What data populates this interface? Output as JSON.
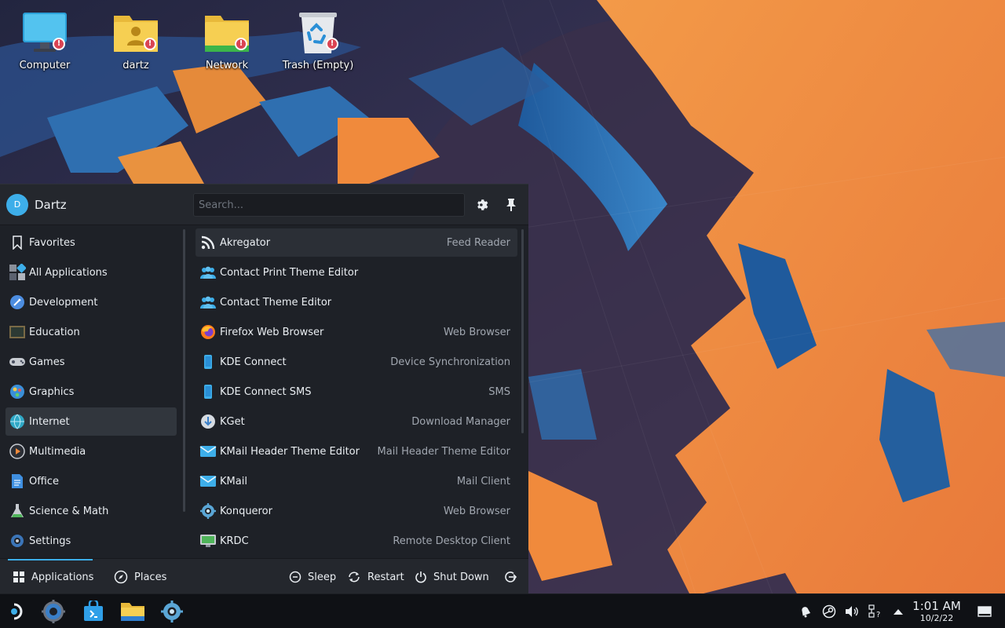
{
  "desktop": {
    "icons": [
      {
        "label": "Computer",
        "icon": "computer-icon"
      },
      {
        "label": "dartz",
        "icon": "home-folder-icon"
      },
      {
        "label": "Network",
        "icon": "network-folder-icon"
      },
      {
        "label": "Trash (Empty)",
        "icon": "trash-icon"
      }
    ],
    "warning_badge": "!"
  },
  "launcher": {
    "user": {
      "initial": "D",
      "name": "Dartz"
    },
    "search": {
      "placeholder": "Search...",
      "value": ""
    },
    "header_buttons": [
      "gear-icon",
      "pin-icon"
    ],
    "categories": [
      {
        "label": "Favorites",
        "icon": "bookmark-icon"
      },
      {
        "label": "All Applications",
        "icon": "all-apps-icon"
      },
      {
        "label": "Development",
        "icon": "development-icon"
      },
      {
        "label": "Education",
        "icon": "education-icon"
      },
      {
        "label": "Games",
        "icon": "gamepad-icon"
      },
      {
        "label": "Graphics",
        "icon": "graphics-icon"
      },
      {
        "label": "Internet",
        "icon": "globe-icon",
        "active": true
      },
      {
        "label": "Multimedia",
        "icon": "multimedia-icon"
      },
      {
        "label": "Office",
        "icon": "office-icon"
      },
      {
        "label": "Science & Math",
        "icon": "science-icon"
      },
      {
        "label": "Settings",
        "icon": "settings-icon"
      }
    ],
    "apps": [
      {
        "name": "Akregator",
        "desc": "Feed Reader",
        "icon": "rss-icon"
      },
      {
        "name": "Contact Print Theme Editor",
        "desc": "",
        "icon": "contacts-icon"
      },
      {
        "name": "Contact Theme Editor",
        "desc": "",
        "icon": "contacts-icon"
      },
      {
        "name": "Firefox Web Browser",
        "desc": "Web Browser",
        "icon": "firefox-icon"
      },
      {
        "name": "KDE Connect",
        "desc": "Device Synchronization",
        "icon": "phone-icon"
      },
      {
        "name": "KDE Connect SMS",
        "desc": "SMS",
        "icon": "phone-icon"
      },
      {
        "name": "KGet",
        "desc": "Download Manager",
        "icon": "download-icon"
      },
      {
        "name": "KMail Header Theme Editor",
        "desc": "Mail Header Theme Editor",
        "icon": "mail-icon"
      },
      {
        "name": "KMail",
        "desc": "Mail Client",
        "icon": "mail-icon"
      },
      {
        "name": "Konqueror",
        "desc": "Web Browser",
        "icon": "konqueror-icon"
      },
      {
        "name": "KRDC",
        "desc": "Remote Desktop Client",
        "icon": "remote-desktop-icon"
      }
    ],
    "footer": {
      "tabs": [
        {
          "label": "Applications",
          "icon": "grid-icon",
          "active": true
        },
        {
          "label": "Places",
          "icon": "compass-icon"
        }
      ],
      "power": [
        {
          "label": "Sleep",
          "icon": "sleep-icon"
        },
        {
          "label": "Restart",
          "icon": "restart-icon"
        },
        {
          "label": "Shut Down",
          "icon": "power-icon"
        }
      ],
      "more_icon": "session-more-icon"
    }
  },
  "taskbar": {
    "launcher_icon": "steam-deck-icon",
    "pinned": [
      "system-settings-icon",
      "discover-icon",
      "dolphin-icon",
      "web-browser-icon"
    ],
    "tray": [
      "notifications-icon",
      "steam-icon",
      "volume-icon",
      "network-icon",
      "tray-expand-icon"
    ],
    "clock": {
      "time": "1:01 AM",
      "date": "10/2/22"
    },
    "show_desktop_icon": "show-desktop-icon"
  },
  "colors": {
    "accent": "#3daee9",
    "panel_bg": "#1e2127",
    "taskbar_bg": "#0f1115",
    "wallpaper_orange": "#f08a3c",
    "wallpaper_blue": "#2f6fb0"
  }
}
